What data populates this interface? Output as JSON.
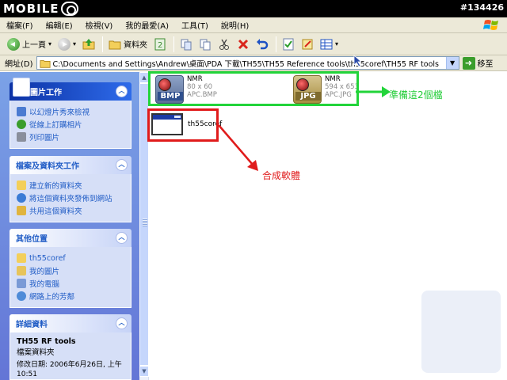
{
  "banner": {
    "logo": "MOBILE",
    "post_id": "#134426"
  },
  "menubar": {
    "items": [
      "檔案(F)",
      "編輯(E)",
      "檢視(V)",
      "我的最愛(A)",
      "工具(T)",
      "說明(H)"
    ]
  },
  "toolbar": {
    "back_label": "上一頁",
    "folders_label": "資料夾"
  },
  "addressbar": {
    "label": "網址(D)",
    "path": "C:\\Documents and Settings\\Andrew\\桌面\\PDA 下載\\TH55\\TH55 Reference tools\\th55coref\\TH55 RF tools",
    "go_label": "移至"
  },
  "taskpane": {
    "picture_tasks": {
      "title": "圖片工作",
      "items": [
        "以幻燈片秀來檢視",
        "從線上訂購相片",
        "列印圖片"
      ]
    },
    "file_tasks": {
      "title": "檔案及資料夾工作",
      "items": [
        "建立新的資料夾",
        "將這個資料夾發佈到網站",
        "共用這個資料夾"
      ]
    },
    "other_places": {
      "title": "其他位置",
      "items": [
        "th55coref",
        "我的圖片",
        "我的電腦",
        "網路上的芳鄰"
      ]
    },
    "details": {
      "title": "詳細資料",
      "name": "TH55 RF tools",
      "type": "檔案資料夾",
      "modified": "修改日期: 2006年6月26日, 上午 10:51"
    }
  },
  "files": [
    {
      "name": "NMR",
      "dims": "80 x 60",
      "filename": "APC.BMP",
      "ext": "BMP"
    },
    {
      "name": "NMR",
      "dims": "594 x 653",
      "filename": "APC.JPG",
      "ext": "JPG"
    },
    {
      "name": "th55coref"
    }
  ],
  "annotations": {
    "green_text": "準備這2個檔",
    "red_text": "合成軟體"
  },
  "colors": {
    "highlight_green": "#22d43a",
    "highlight_red": "#e01b1b",
    "taskpane_blue": "#6375d6"
  }
}
